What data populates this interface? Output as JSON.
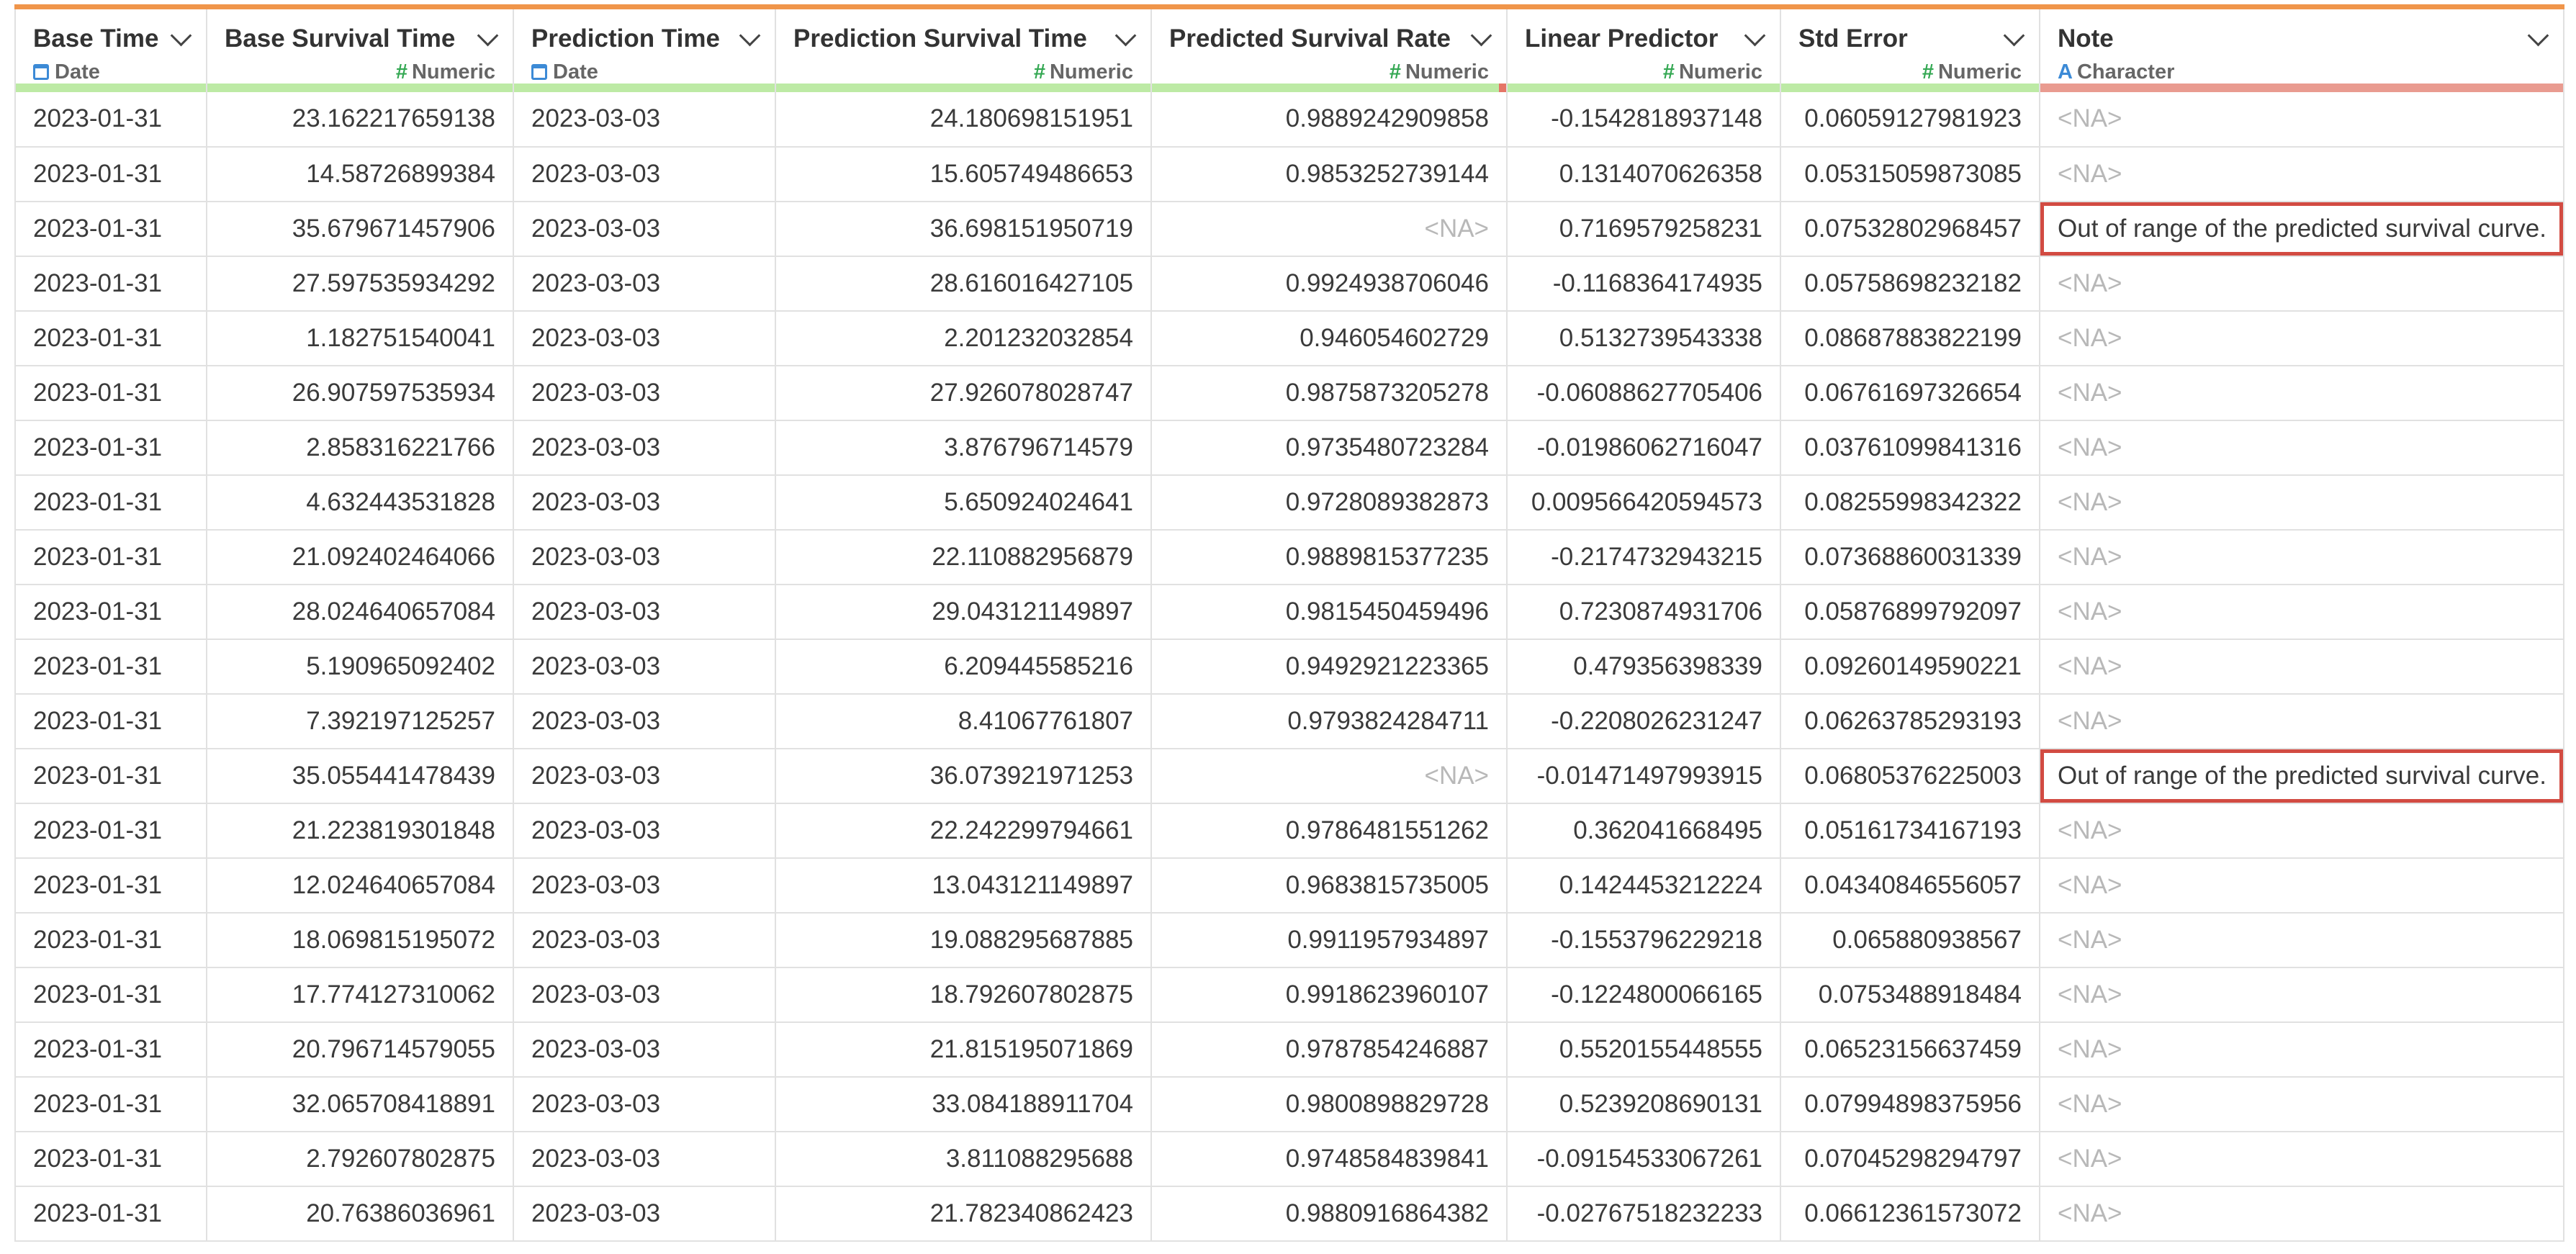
{
  "columns": [
    {
      "name": "Base Time",
      "type": "Date",
      "icon": "calendar-icon",
      "quality": "good"
    },
    {
      "name": "Base Survival Time",
      "type": "Numeric",
      "icon": "hash-icon",
      "quality": "good"
    },
    {
      "name": "Prediction Time",
      "type": "Date",
      "icon": "calendar-icon",
      "quality": "good"
    },
    {
      "name": "Prediction Survival Time",
      "type": "Numeric",
      "icon": "hash-icon",
      "quality": "good"
    },
    {
      "name": "Predicted Survival Rate",
      "type": "Numeric",
      "icon": "hash-icon",
      "quality": "has-missing"
    },
    {
      "name": "Linear Predictor",
      "type": "Numeric",
      "icon": "hash-icon",
      "quality": "good"
    },
    {
      "name": "Std Error",
      "type": "Numeric",
      "icon": "hash-icon",
      "quality": "good"
    },
    {
      "name": "Note",
      "type": "Character",
      "icon": "character-icon",
      "quality": "mostly-missing"
    }
  ],
  "na_label": "<NA>",
  "colors": {
    "accent": "#f0954a",
    "quality_good": "#bdeaa5",
    "quality_bad": "#e99b90",
    "highlight": "#d24b42"
  },
  "rows": [
    [
      "2023-01-31",
      "23.162217659138",
      "2023-03-03",
      "24.180698151951",
      "0.9889242909858",
      "-0.1542818937148",
      "0.06059127981923",
      null
    ],
    [
      "2023-01-31",
      "14.58726899384",
      "2023-03-03",
      "15.605749486653",
      "0.9853252739144",
      "0.1314070626358",
      "0.05315059873085",
      null
    ],
    [
      "2023-01-31",
      "35.679671457906",
      "2023-03-03",
      "36.698151950719",
      null,
      "0.7169579258231",
      "0.07532802968457",
      "Out of range of the predicted survival curve."
    ],
    [
      "2023-01-31",
      "27.597535934292",
      "2023-03-03",
      "28.616016427105",
      "0.9924938706046",
      "-0.1168364174935",
      "0.05758698232182",
      null
    ],
    [
      "2023-01-31",
      "1.182751540041",
      "2023-03-03",
      "2.201232032854",
      "0.946054602729",
      "0.5132739543338",
      "0.08687883822199",
      null
    ],
    [
      "2023-01-31",
      "26.907597535934",
      "2023-03-03",
      "27.926078028747",
      "0.9875873205278",
      "-0.06088627705406",
      "0.06761697326654",
      null
    ],
    [
      "2023-01-31",
      "2.858316221766",
      "2023-03-03",
      "3.876796714579",
      "0.9735480723284",
      "-0.01986062716047",
      "0.03761099841316",
      null
    ],
    [
      "2023-01-31",
      "4.632443531828",
      "2023-03-03",
      "5.650924024641",
      "0.9728089382873",
      "0.009566420594573",
      "0.08255998342322",
      null
    ],
    [
      "2023-01-31",
      "21.092402464066",
      "2023-03-03",
      "22.110882956879",
      "0.9889815377235",
      "-0.2174732943215",
      "0.07368860031339",
      null
    ],
    [
      "2023-01-31",
      "28.024640657084",
      "2023-03-03",
      "29.043121149897",
      "0.9815450459496",
      "0.7230874931706",
      "0.05876899792097",
      null
    ],
    [
      "2023-01-31",
      "5.190965092402",
      "2023-03-03",
      "6.209445585216",
      "0.9492921223365",
      "0.479356398339",
      "0.09260149590221",
      null
    ],
    [
      "2023-01-31",
      "7.392197125257",
      "2023-03-03",
      "8.41067761807",
      "0.9793824284711",
      "-0.2208026231247",
      "0.06263785293193",
      null
    ],
    [
      "2023-01-31",
      "35.055441478439",
      "2023-03-03",
      "36.073921971253",
      null,
      "-0.01471497993915",
      "0.06805376225003",
      "Out of range of the predicted survival curve."
    ],
    [
      "2023-01-31",
      "21.223819301848",
      "2023-03-03",
      "22.242299794661",
      "0.9786481551262",
      "0.362041668495",
      "0.05161734167193",
      null
    ],
    [
      "2023-01-31",
      "12.024640657084",
      "2023-03-03",
      "13.043121149897",
      "0.9683815735005",
      "0.1424453212224",
      "0.04340846556057",
      null
    ],
    [
      "2023-01-31",
      "18.069815195072",
      "2023-03-03",
      "19.088295687885",
      "0.9911957934897",
      "-0.1553796229218",
      "0.065880938567",
      null
    ],
    [
      "2023-01-31",
      "17.774127310062",
      "2023-03-03",
      "18.792607802875",
      "0.9918623960107",
      "-0.1224800066165",
      "0.0753488918484",
      null
    ],
    [
      "2023-01-31",
      "20.796714579055",
      "2023-03-03",
      "21.815195071869",
      "0.9787854246887",
      "0.5520155448555",
      "0.06523156637459",
      null
    ],
    [
      "2023-01-31",
      "32.065708418891",
      "2023-03-03",
      "33.084188911704",
      "0.9800898829728",
      "0.5239208690131",
      "0.07994898375956",
      null
    ],
    [
      "2023-01-31",
      "2.792607802875",
      "2023-03-03",
      "3.811088295688",
      "0.9748584839841",
      "-0.09154533067261",
      "0.07045298294797",
      null
    ],
    [
      "2023-01-31",
      "20.76386036961",
      "2023-03-03",
      "21.782340862423",
      "0.9880916864382",
      "-0.02767518232233",
      "0.06612361573072",
      null
    ]
  ]
}
